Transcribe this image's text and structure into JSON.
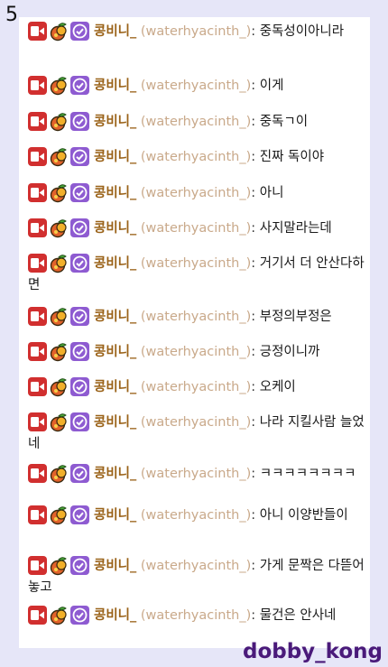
{
  "page_number": "5",
  "watermark": "dobby_kong",
  "badges": [
    "live-camera-icon",
    "fruit-badge-icon",
    "verified-check-icon"
  ],
  "colors": {
    "nick": "#9a6218",
    "login": "#c9a98a",
    "live": "#d12f2f",
    "verified": "#8e5bd1"
  },
  "messages": [
    {
      "nick": "콩비니_",
      "login": "(waterhyacinth_)",
      "colon": ":",
      "text": "중독성이아니라"
    },
    {
      "nick": "콩비니_",
      "login": "(waterhyacinth_)",
      "colon": ":",
      "text": "이게"
    },
    {
      "nick": "콩비니_",
      "login": "(waterhyacinth_)",
      "colon": ":",
      "text": "중독ㄱ이"
    },
    {
      "nick": "콩비니_",
      "login": "(waterhyacinth_)",
      "colon": ":",
      "text": "진짜 독이야"
    },
    {
      "nick": "콩비니_",
      "login": "(waterhyacinth_)",
      "colon": ":",
      "text": "아니"
    },
    {
      "nick": "콩비니_",
      "login": "(waterhyacinth_)",
      "colon": ":",
      "text": "사지말라는데"
    },
    {
      "nick": "콩비니_",
      "login": "(waterhyacinth_)",
      "colon": ":",
      "text": "거기서 더 안산다하면"
    },
    {
      "nick": "콩비니_",
      "login": "(waterhyacinth_)",
      "colon": ":",
      "text": "부정의부정은"
    },
    {
      "nick": "콩비니_",
      "login": "(waterhyacinth_)",
      "colon": ":",
      "text": "긍정이니까"
    },
    {
      "nick": "콩비니_",
      "login": "(waterhyacinth_)",
      "colon": ":",
      "text": "오케이"
    },
    {
      "nick": "콩비니_",
      "login": "(waterhyacinth_)",
      "colon": ":",
      "text": "나라 지킬사람 늘었네"
    },
    {
      "nick": "콩비니_",
      "login": "(waterhyacinth_)",
      "colon": ":",
      "text": "ㅋㅋㅋㅋㅋㅋㅋㅋ"
    },
    {
      "nick": "콩비니_",
      "login": "(waterhyacinth_)",
      "colon": ":",
      "text": "아니 이양반들이"
    },
    {
      "nick": "콩비니_",
      "login": "(waterhyacinth_)",
      "colon": ":",
      "text": "가게 문짝은 다뜯어놓고"
    },
    {
      "nick": "콩비니_",
      "login": "(waterhyacinth_)",
      "colon": ":",
      "text": "물건은 안사네"
    }
  ]
}
